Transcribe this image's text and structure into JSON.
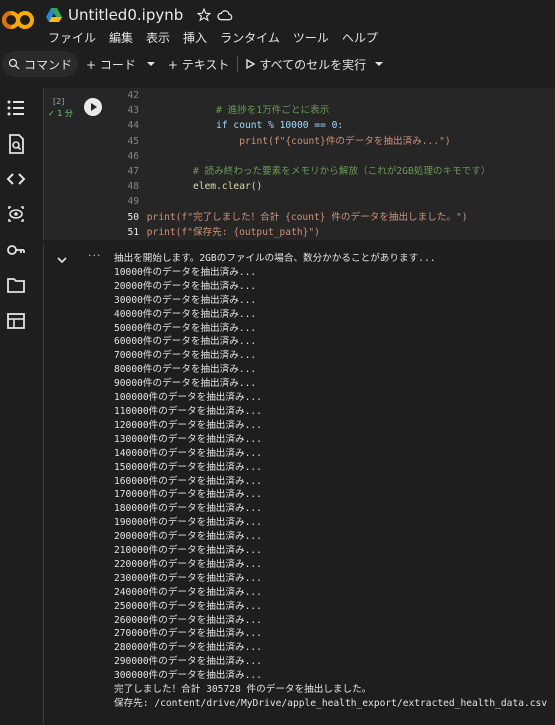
{
  "app": {
    "title": "Untitled0.ipynb",
    "logo_text": "CO",
    "star_icon": "star-outline-icon",
    "cloud_icon": "cloud-icon"
  },
  "menu": [
    "ファイル",
    "編集",
    "表示",
    "挿入",
    "ランタイム",
    "ツール",
    "ヘルプ"
  ],
  "toolbar": {
    "command_label": "コマンド",
    "add_code_label": "+ コード",
    "add_text_label": "+ テキスト",
    "run_all_label": "すべてのセルを実行"
  },
  "cell": {
    "exec_count": "[2]",
    "exec_time": "1 分",
    "lines": [
      {
        "n": "42",
        "t": ""
      },
      {
        "n": "43",
        "t": "            # 進捗を1万件ごとに表示"
      },
      {
        "n": "44",
        "t": "            if count % 10000 == 0:"
      },
      {
        "n": "45",
        "t": "                print(f\"{count}件のデータを抽出済み...\")"
      },
      {
        "n": "46",
        "t": ""
      },
      {
        "n": "47",
        "t": "        # 読み終わった要素をメモリから解放（これが2GB処理のキモです）"
      },
      {
        "n": "48",
        "t": "        elem.clear()"
      },
      {
        "n": "49",
        "t": ""
      },
      {
        "n": "50",
        "t": "print(f\"完了しました！合計 {count} 件のデータを抽出しました。\")"
      },
      {
        "n": "51",
        "t": "print(f\"保存先: {output_path}\")"
      }
    ]
  },
  "output": {
    "lines": [
      "抽出を開始します。2GBのファイルの場合、数分かかることがあります...",
      "10000件のデータを抽出済み...",
      "20000件のデータを抽出済み...",
      "30000件のデータを抽出済み...",
      "40000件のデータを抽出済み...",
      "50000件のデータを抽出済み...",
      "60000件のデータを抽出済み...",
      "70000件のデータを抽出済み...",
      "80000件のデータを抽出済み...",
      "90000件のデータを抽出済み...",
      "100000件のデータを抽出済み...",
      "110000件のデータを抽出済み...",
      "120000件のデータを抽出済み...",
      "130000件のデータを抽出済み...",
      "140000件のデータを抽出済み...",
      "150000件のデータを抽出済み...",
      "160000件のデータを抽出済み...",
      "170000件のデータを抽出済み...",
      "180000件のデータを抽出済み...",
      "190000件のデータを抽出済み...",
      "200000件のデータを抽出済み...",
      "210000件のデータを抽出済み...",
      "220000件のデータを抽出済み...",
      "230000件のデータを抽出済み...",
      "240000件のデータを抽出済み...",
      "250000件のデータを抽出済み...",
      "260000件のデータを抽出済み...",
      "270000件のデータを抽出済み...",
      "280000件のデータを抽出済み...",
      "290000件のデータを抽出済み...",
      "300000件のデータを抽出済み...",
      "完了しました！合計 305728 件のデータを抽出しました。",
      "保存先: /content/drive/MyDrive/apple_health_export/extracted_health_data.csv"
    ]
  },
  "sidebar": [
    "table-of-contents-icon",
    "find-icon",
    "code-snippets-icon",
    "variables-icon",
    "secrets-key-icon",
    "files-folder-icon",
    "data-table-icon"
  ]
}
